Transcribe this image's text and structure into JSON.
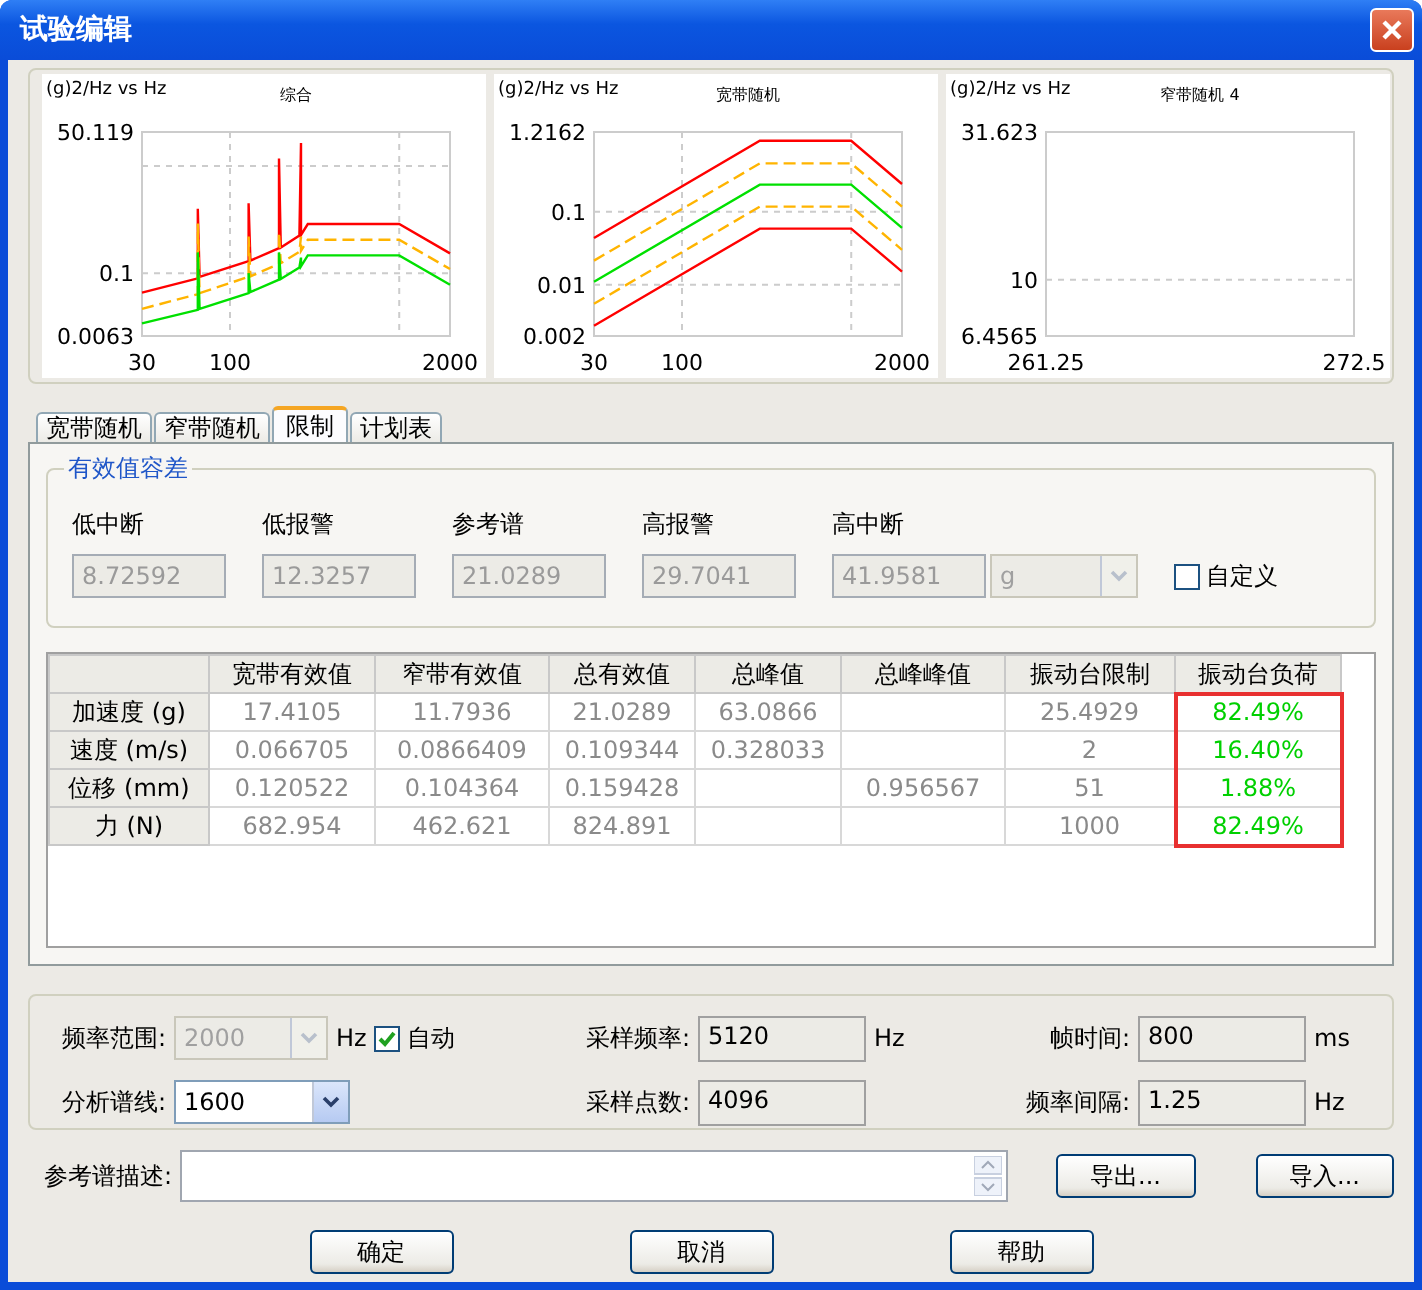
{
  "window": {
    "title": "试验编辑"
  },
  "charts": [
    {
      "kind": "composite",
      "title": "综合",
      "ylabel": "(g)2/Hz vs Hz",
      "y_labels": [
        "50.119",
        "0.1",
        "0.0063"
      ],
      "x_labels": [
        "30",
        "100",
        "2000"
      ]
    },
    {
      "kind": "broadband",
      "title": "宽带随机",
      "ylabel": "(g)2/Hz vs Hz",
      "y_labels": [
        "1.2162",
        "0.1",
        "0.01",
        "0.002"
      ],
      "x_labels": [
        "30",
        "100",
        "2000"
      ]
    },
    {
      "kind": "empty",
      "title": "窄带随机 4",
      "ylabel": "(g)2/Hz vs Hz",
      "y_labels": [
        "31.623",
        "10",
        "6.4565"
      ],
      "x_labels": [
        "261.25",
        "272.5"
      ]
    }
  ],
  "tabs": [
    {
      "label": "宽带随机",
      "selected": false
    },
    {
      "label": "窄带随机",
      "selected": false
    },
    {
      "label": "限制",
      "selected": true
    },
    {
      "label": "计划表",
      "selected": false
    }
  ],
  "tolerance": {
    "title": "有效值容差",
    "fields": [
      {
        "label": "低中断",
        "value": "8.72592",
        "disabled": true
      },
      {
        "label": "低报警",
        "value": "12.3257",
        "disabled": true
      },
      {
        "label": "参考谱",
        "value": "21.0289",
        "disabled": true
      },
      {
        "label": "高报警",
        "value": "29.7041",
        "disabled": true
      },
      {
        "label": "高中断",
        "value": "41.9581",
        "disabled": true
      }
    ],
    "unit": {
      "value": "g",
      "disabled": true
    },
    "custom": {
      "label": "自定义",
      "checked": false
    }
  },
  "table": {
    "columns": [
      {
        "label": "宽带有效值",
        "highlighted": false
      },
      {
        "label": "窄带有效值",
        "highlighted": false
      },
      {
        "label": "总有效值",
        "highlighted": false
      },
      {
        "label": "总峰值",
        "highlighted": false
      },
      {
        "label": "总峰峰值",
        "highlighted": false
      },
      {
        "label": "振动台限制",
        "highlighted": false
      },
      {
        "label": "振动台负荷",
        "highlighted": true
      }
    ],
    "rows": [
      {
        "label": "加速度 (g)",
        "cells": [
          "17.4105",
          "11.7936",
          "21.0289",
          "63.0866",
          "",
          "25.4929",
          "82.49%"
        ]
      },
      {
        "label": "速度 (m/s)",
        "cells": [
          "0.066705",
          "0.0866409",
          "0.109344",
          "0.328033",
          "",
          "2",
          "16.40%"
        ]
      },
      {
        "label": "位移 (mm)",
        "cells": [
          "0.120522",
          "0.104364",
          "0.159428",
          "",
          "0.956567",
          "51",
          "1.88%"
        ]
      },
      {
        "label": "力 (N)",
        "cells": [
          "682.954",
          "462.621",
          "824.891",
          "",
          "",
          "1000",
          "82.49%"
        ]
      }
    ]
  },
  "settings": {
    "freq_range": {
      "label": "频率范围:",
      "value": "2000",
      "unit": "Hz",
      "disabled": true
    },
    "auto": {
      "label": "自动",
      "checked": true
    },
    "lines": {
      "label": "分析谱线:",
      "value": "1600",
      "disabled": false
    },
    "sample_rate": {
      "label": "采样频率:",
      "value": "5120",
      "unit": "Hz"
    },
    "sample_points": {
      "label": "采样点数:",
      "value": "4096"
    },
    "frame_time": {
      "label": "帧时间:",
      "value": "800",
      "unit": "ms"
    },
    "freq_interval": {
      "label": "频率间隔:",
      "value": "1.25",
      "unit": "Hz"
    }
  },
  "description": {
    "label": "参考谱描述:"
  },
  "side_buttons": [
    "导出...",
    "导入..."
  ],
  "buttons": [
    "确定",
    "取消",
    "帮助"
  ]
}
